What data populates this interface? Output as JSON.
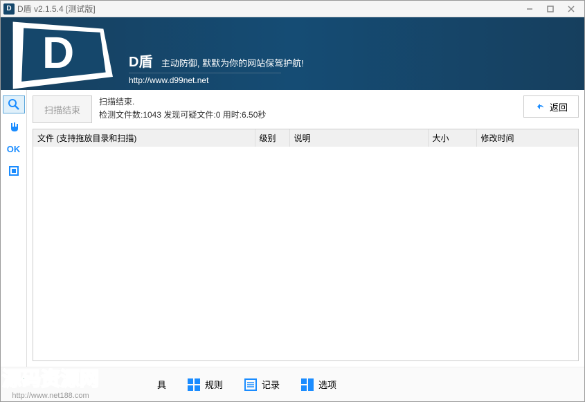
{
  "titlebar": {
    "icon_text": "D",
    "title": "D盾 v2.1.5.4 [测试版]"
  },
  "banner": {
    "title": "D盾",
    "subtitle": "主动防御, 默默为你的网站保驾护航!",
    "url": "http://www.d99net.net"
  },
  "sidebar": {
    "items": [
      {
        "name": "scan",
        "label": "Q",
        "active": true
      },
      {
        "name": "shield",
        "label": "🛡"
      },
      {
        "name": "ok",
        "label": "OK"
      },
      {
        "name": "box",
        "label": "▣"
      }
    ]
  },
  "toolbar": {
    "scan_button": "扫描结束",
    "status_line1": "扫描结束.",
    "status_line2": "检测文件数:1043 发现可疑文件:0 用时:6.50秒",
    "return_button": "返回"
  },
  "table": {
    "columns": [
      "文件 (支持拖放目录和扫描)",
      "级别",
      "说明",
      "大小",
      "修改时间"
    ],
    "rows": []
  },
  "bottom_tabs": [
    {
      "label": "具"
    },
    {
      "label": "规则"
    },
    {
      "label": "记录"
    },
    {
      "label": "选项"
    }
  ],
  "watermark": {
    "text": "源码资源网",
    "url": "http://www.net188.com"
  }
}
